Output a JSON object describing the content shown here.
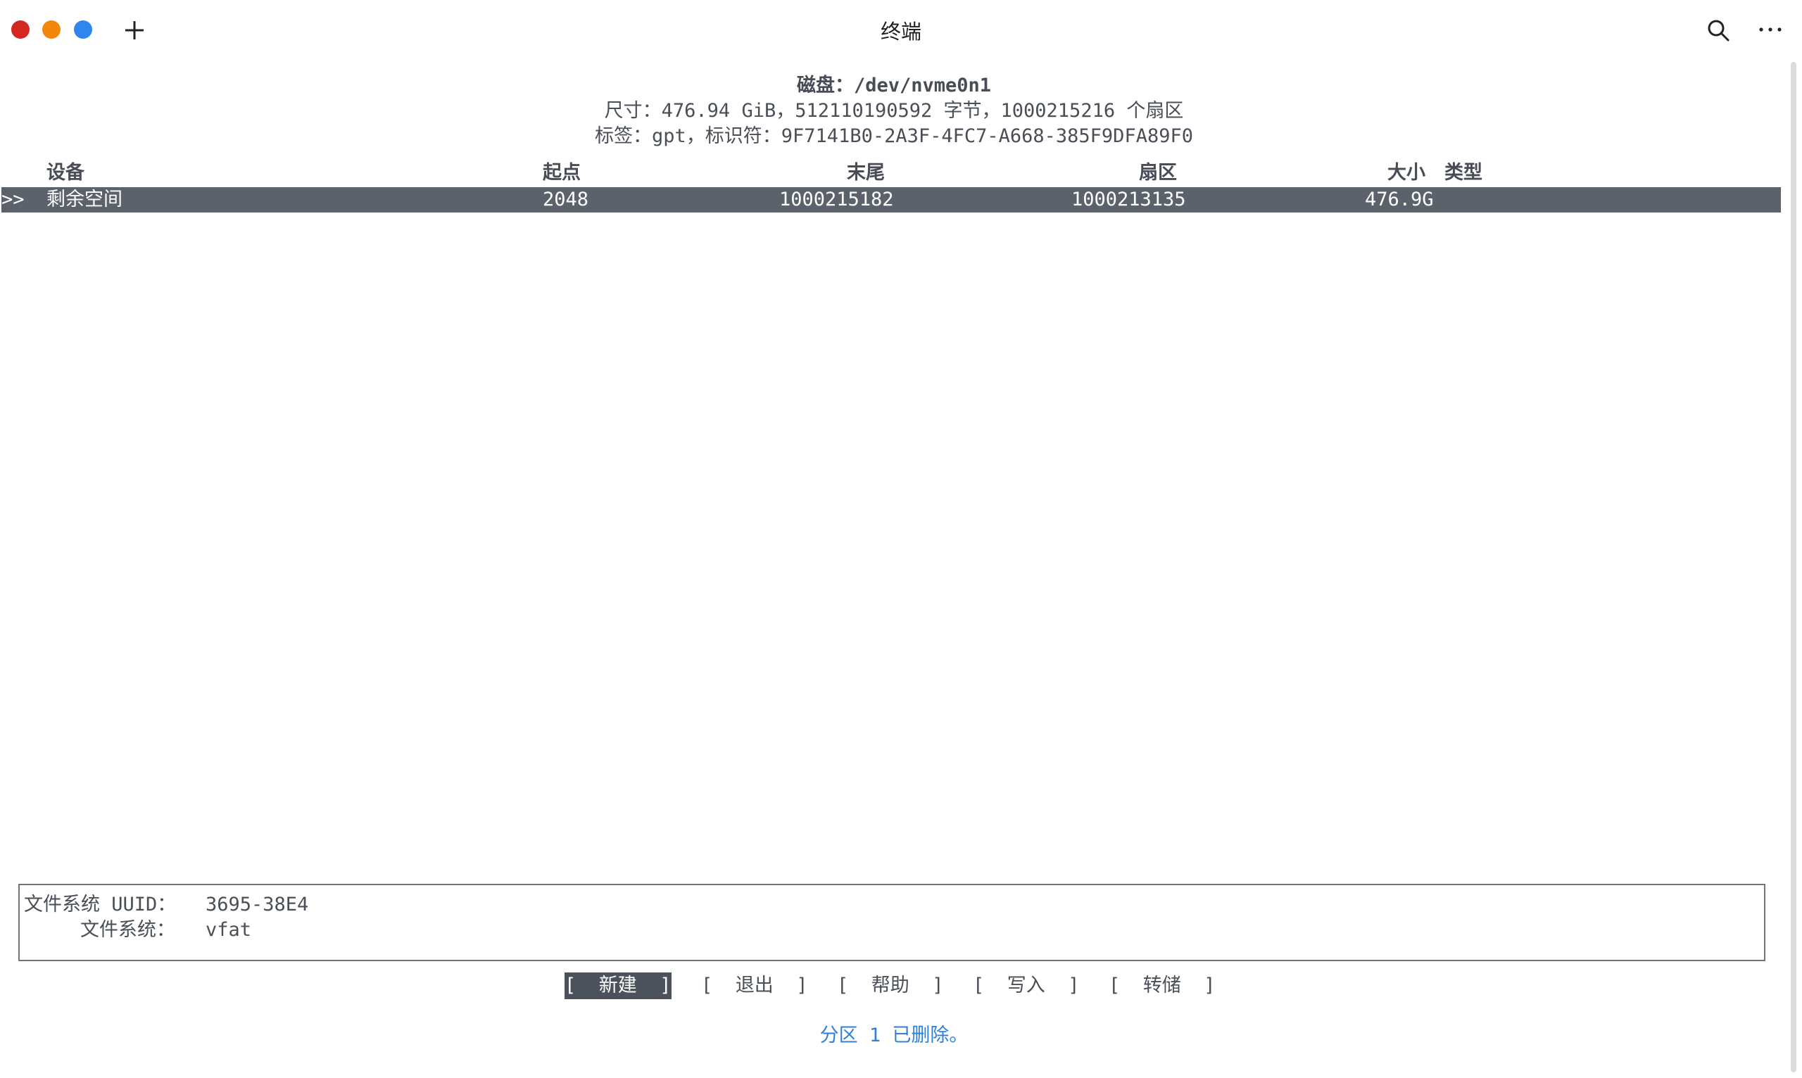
{
  "window": {
    "title": "终端"
  },
  "header": {
    "disk": "磁盘：/dev/nvme0n1",
    "size": "尺寸：476.94 GiB，512110190592 字节，1000215216 个扇区",
    "label": "标签：gpt，标识符：9F7141B0-2A3F-4FC7-A668-385F9DFA89F0"
  },
  "table": {
    "columns": [
      "设备",
      "起点",
      "末尾",
      "扇区",
      "大小",
      "类型"
    ],
    "rows": [
      {
        "marker": ">>",
        "device": "剩余空间",
        "start": "2048",
        "end": "1000215182",
        "sectors": "1000213135",
        "size": "476.9G",
        "type": ""
      }
    ]
  },
  "info": {
    "uuid_label": "文件系统 UUID：",
    "uuid_value": "3695-38E4",
    "fs_label": "文件系统：",
    "fs_value": "vfat"
  },
  "menu": [
    {
      "label": "[  新建  ]",
      "selected": true
    },
    {
      "label": "[  退出  ]",
      "selected": false
    },
    {
      "label": "[  帮助  ]",
      "selected": false
    },
    {
      "label": "[  写入  ]",
      "selected": false
    },
    {
      "label": "[  转储  ]",
      "selected": false
    }
  ],
  "status": "分区 1 已删除。",
  "colors": {
    "close": "#d3271f",
    "minimize": "#f2870c",
    "maximize": "#2f86ef",
    "selection": "#5c626c",
    "status": "#2f7fd8"
  },
  "icons": [
    "plus-icon",
    "search-icon",
    "more-icon"
  ]
}
